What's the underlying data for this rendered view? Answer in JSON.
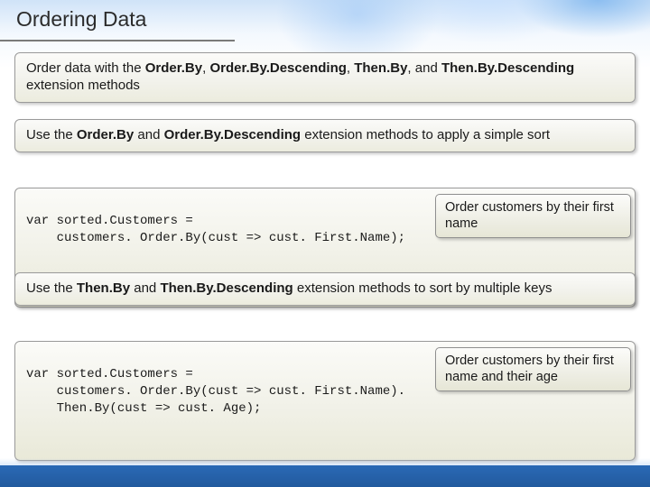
{
  "title": "Ordering Data",
  "card1": {
    "pre": "Order data with the ",
    "m1": "Order.By",
    "sep1": ", ",
    "m2": "Order.By.Descending",
    "sep2": ", ",
    "m3": "Then.By",
    "sep3": ", and ",
    "m4": "Then.By.Descending",
    "post": " extension methods"
  },
  "card2": {
    "pre": "Use the ",
    "m1": "Order.By",
    "mid": " and ",
    "m2": "Order.By.Descending",
    "post": " extension methods to apply a simple sort"
  },
  "code1": {
    "line1": "var sorted.Customers =",
    "line2": "    customers. Order.By(cust => cust. First.Name);"
  },
  "callout1": "Order customers by their first name",
  "card3": {
    "pre": "Use the ",
    "m1": "Then.By",
    "mid": " and ",
    "m2": "Then.By.Descending",
    "post": " extension methods to sort by multiple keys"
  },
  "code2": {
    "line1": "var sorted.Customers =",
    "line2": "    customers. Order.By(cust => cust. First.Name).",
    "line3": "    Then.By(cust => cust. Age);"
  },
  "callout2": "Order customers by their first name and their age"
}
